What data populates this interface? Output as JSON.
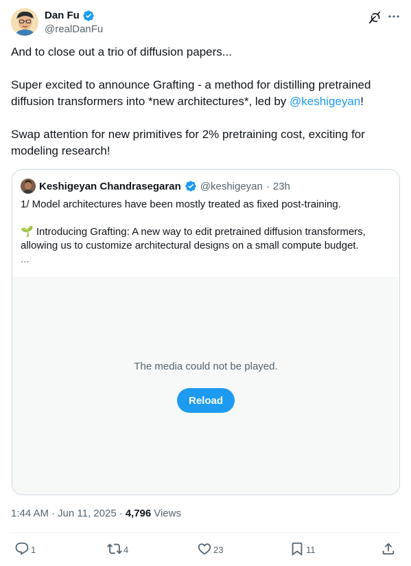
{
  "author": {
    "name": "Dan Fu",
    "handle": "@realDanFu"
  },
  "body": {
    "line1": "And to close out a trio of diffusion papers...",
    "para2_prefix": "Super excited to announce Grafting - a method for distilling pretrained diffusion transformers into *new architectures*, led by ",
    "para2_mention": "@keshigeyan",
    "para2_suffix": "!",
    "para3": "Swap attention for new primitives for 2% pretraining cost, exciting for modeling research!"
  },
  "quote": {
    "name": "Keshigeyan Chandrasegaran",
    "handle": "@keshigeyan",
    "time_sep": "·",
    "time": "23h",
    "line1": "1/ Model architectures have been mostly treated as fixed post-training.",
    "line2": "🌱 Introducing Grafting: A new way to edit pretrained diffusion transformers, allowing us to customize architectural designs on a small compute budget.",
    "ellipsis": "...",
    "media_message": "The media could not be played.",
    "reload_label": "Reload"
  },
  "meta": {
    "time": "1:44 AM",
    "sep1": "·",
    "date": "Jun 11, 2025",
    "sep2": "·",
    "views_count": "4,796",
    "views_label": "Views"
  },
  "actions": {
    "replies": "1",
    "reposts": "4",
    "likes": "23",
    "bookmarks": "11"
  },
  "colors": {
    "accent": "#1d9bf0",
    "text": "#0f1419",
    "secondary": "#536471",
    "border": "#cfd9de",
    "media_bg": "#f7f9f9"
  },
  "icons": [
    "verified-badge-icon",
    "grok-icon",
    "more-icon",
    "reply-icon",
    "retweet-icon",
    "like-icon",
    "bookmark-icon",
    "share-icon"
  ]
}
